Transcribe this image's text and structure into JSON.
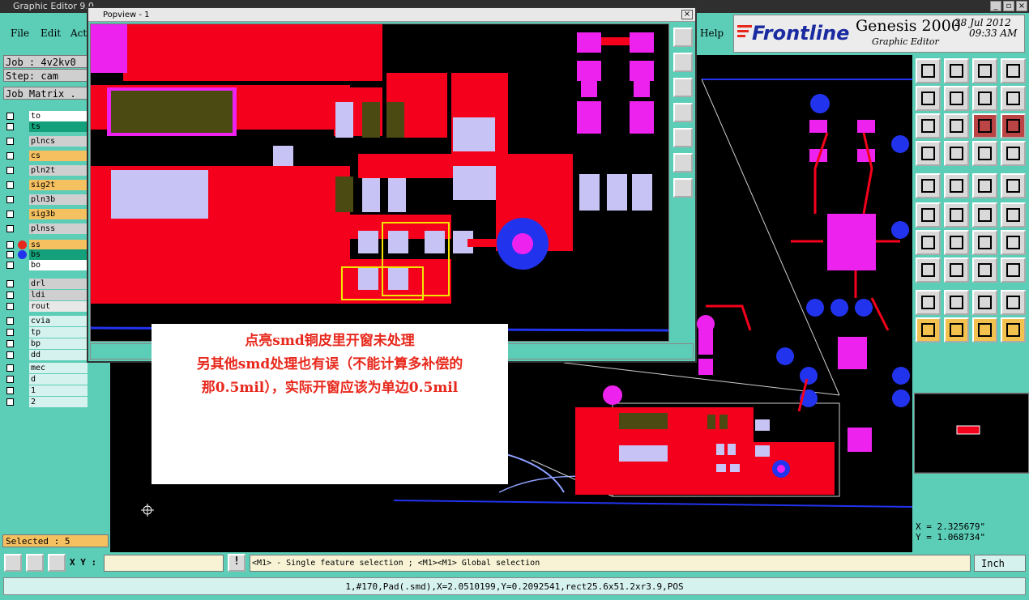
{
  "window": {
    "title": "Graphic Editor 9.0",
    "popup_title": "Popview - 1"
  },
  "menu": {
    "file": "File",
    "edit": "Edit",
    "actions": "Act",
    "help": "Help"
  },
  "brand": {
    "logo": "Frontline",
    "product": "Genesis 2000",
    "subtitle": "Graphic Editor",
    "date": "28 Jul 2012",
    "time": "09:33 AM"
  },
  "job": {
    "job_label": "Job : 4v2kv0",
    "step_label": "Step: cam",
    "matrix_label": "Job Matrix ."
  },
  "layers": [
    {
      "name": "to",
      "bg": "#ffffff"
    },
    {
      "name": "ts",
      "bg": "#13a07a"
    },
    {
      "name": "plncs",
      "bg": "#cfcfcf"
    },
    {
      "name": "cs",
      "bg": "#f5c060"
    },
    {
      "name": "pln2t",
      "bg": "#cfcfcf"
    },
    {
      "name": "sig2t",
      "bg": "#f5c060"
    },
    {
      "name": "pln3b",
      "bg": "#cfcfcf"
    },
    {
      "name": "sig3b",
      "bg": "#f5c060"
    },
    {
      "name": "plnss",
      "bg": "#cfcfcf"
    },
    {
      "name": "ss",
      "bg": "#f5c060",
      "dot": "#e8281c"
    },
    {
      "name": "bs",
      "bg": "#13a07a",
      "dot": "#2233ee"
    },
    {
      "name": "bo",
      "bg": "#ffffff"
    },
    {
      "name": "drl",
      "bg": "#cfcfcf"
    },
    {
      "name": "ldi",
      "bg": "#cfcfcf"
    },
    {
      "name": "rout",
      "bg": "#e8e8e8"
    },
    {
      "name": "cvia",
      "bg": "#d6f2ee"
    },
    {
      "name": "tp",
      "bg": "#d6f2ee"
    },
    {
      "name": "bp",
      "bg": "#d6f2ee"
    },
    {
      "name": "dd",
      "bg": "#d6f2ee"
    },
    {
      "name": "mec",
      "bg": "#d6f2ee"
    },
    {
      "name": "d",
      "bg": "#d6f2ee"
    },
    {
      "name": "1",
      "bg": "#d6f2ee"
    },
    {
      "name": "2",
      "bg": "#d6f2ee"
    }
  ],
  "selection": {
    "selected_label": "Selected : 5"
  },
  "coords": {
    "x": "X = 2.325679\"",
    "y": "Y = 1.068734\""
  },
  "bottom": {
    "xy_label": "X Y :",
    "xy_value": "",
    "hint": "<M1> - Single feature selection ; <M1><M1> Global selection",
    "units": "Inch",
    "status": "1,#170,Pad(.smd),X=2.0510199,Y=0.2092541,rect25.6x51.2xr3.9,POS"
  },
  "note": {
    "line1": "点亮smd铜皮里开窗未处理",
    "line2": "另其他smd处理也有误（不能计算多补偿的",
    "line3": "那0.5mil），实际开窗应该为单边0.5mil"
  },
  "colors": {
    "copper": "#f4001c",
    "pad": "#c8c3f5",
    "soldermask": "#ee22ee",
    "via": "#2233ee",
    "olive": "#4a4a12",
    "panel": "#5ccdb7"
  }
}
